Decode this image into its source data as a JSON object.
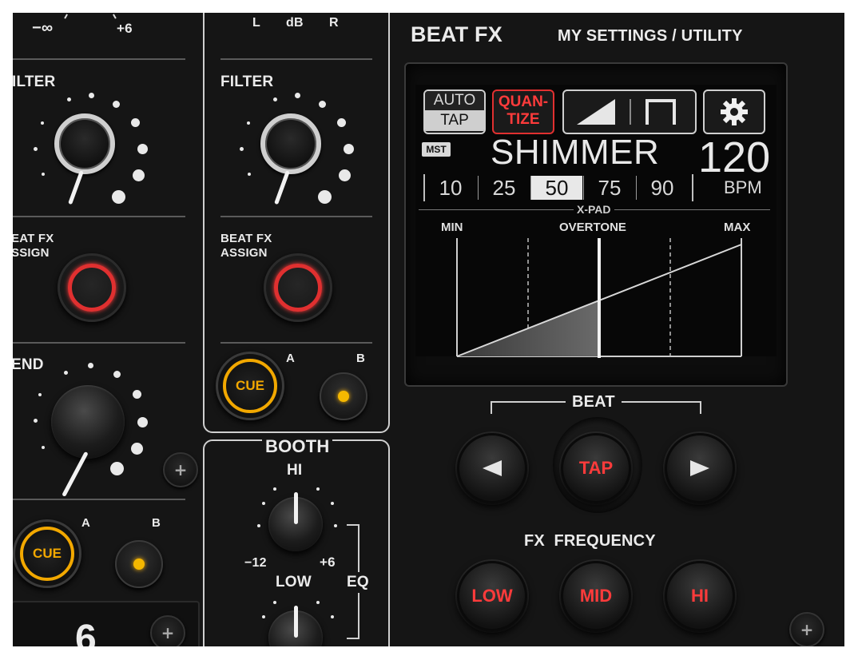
{
  "left_channel": {
    "level_min": "−∞",
    "level_max": "+6",
    "filter_label": "ILTER",
    "beat_fx_assign_label_line1": "EAT FX",
    "beat_fx_assign_label_line2": "SSIGN",
    "send_label": "END",
    "cue_label": "CUE",
    "xf_a_label": "A",
    "xf_b_label": "B",
    "channel_number": "6"
  },
  "right_channel": {
    "level_l": "L",
    "level_db": "dB",
    "level_r": "R",
    "filter_label": "FILTER",
    "beat_fx_assign_label_line1": "BEAT FX",
    "beat_fx_assign_label_line2": "ASSIGN",
    "cue_label": "CUE",
    "xf_a_label": "A",
    "xf_b_label": "B"
  },
  "booth": {
    "title": "BOOTH",
    "hi_label": "HI",
    "min_label": "−12",
    "max_label": "+6",
    "low_label": "LOW",
    "eq_label": "EQ"
  },
  "beat_fx": {
    "title": "BEAT FX",
    "settings_label": "MY SETTINGS / UTILITY",
    "screen": {
      "auto_label": "AUTO",
      "tap_label": "TAP",
      "quantize_line1": "QUAN-",
      "quantize_line2": "TIZE",
      "mst_badge": "MST",
      "effect_name": "SHIMMER",
      "bpm_value": "120",
      "bpm_unit": "BPM",
      "beat_values": [
        "10",
        "25",
        "50",
        "75",
        "90"
      ],
      "beat_selected": "50",
      "xpad_label": "X-PAD",
      "xpad_min": "MIN",
      "xpad_param": "OVERTONE",
      "xpad_max": "MAX",
      "xpad_position": 0.5,
      "gear_icon": "gear-icon",
      "ramp_icon": "ramp-icon",
      "gate_icon": "gate-icon"
    },
    "beat_label": "BEAT",
    "beat_left_icon": "triangle-left-icon",
    "beat_right_icon": "triangle-right-icon",
    "tap_button": "TAP",
    "fx_frequency_label": "FX  FREQUENCY",
    "freq_buttons": [
      "LOW",
      "MID",
      "HI"
    ],
    "colors": {
      "accent_red": "#e03030",
      "cue_amber": "#f2a800",
      "panel": "#151515"
    }
  }
}
